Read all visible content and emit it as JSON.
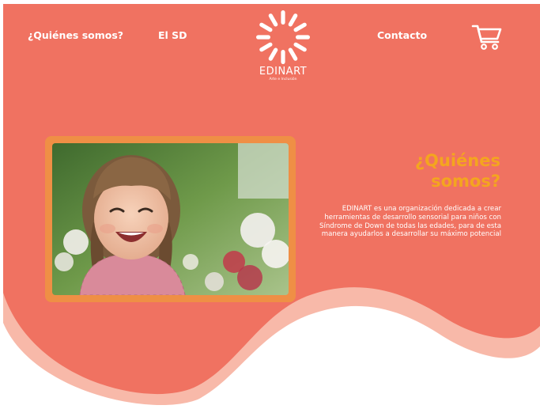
{
  "nav": {
    "quienes": "¿Quiénes somos?",
    "sd": "El SD",
    "contacto": "Contacto",
    "cart_icon": "shopping-cart-icon"
  },
  "logo": {
    "name": "EDINART",
    "tagline": "Arte e Inclusión",
    "icon": "sun-logo-icon"
  },
  "hero": {
    "title_line1": "¿Quiénes",
    "title_line2": "somos?",
    "body": "EDINART es una organización dedicada a crear herramientas de desarrollo sensorial para niños con Síndrome de Down de todas las edades, para de esta manera ayudarlos a desarrollar su máximo potencial",
    "photo": "smiling-child-photo"
  },
  "colors": {
    "primary": "#f07261",
    "wave_shadow": "#f8b9a9",
    "title_accent": "#f4a51f",
    "photo_frame": "#ef8f45"
  }
}
